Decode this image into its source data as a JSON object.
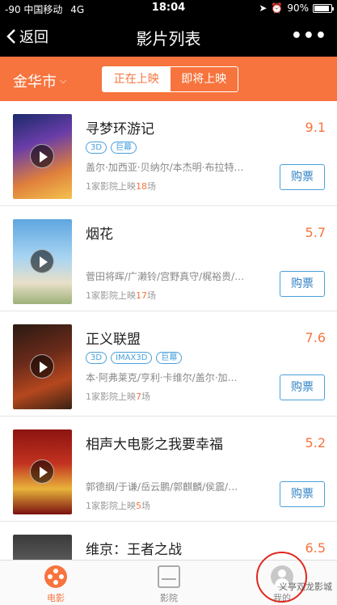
{
  "status_bar": {
    "carrier": "-90 中国移动",
    "network": "4G",
    "time": "18:04",
    "battery": "90%",
    "battery_level": 0.9
  },
  "nav": {
    "back_label": "返回",
    "title": "影片列表",
    "more_label": "•••"
  },
  "filter": {
    "city": "金华市",
    "tabs": [
      {
        "label": "正在上映",
        "active": true
      },
      {
        "label": "即将上映",
        "active": false
      }
    ]
  },
  "movies": [
    {
      "title": "寻梦环游记",
      "score": "9.1",
      "tags": [
        "3D",
        "巨幕"
      ],
      "cast": "盖尔·加西亚·贝纳尔/本杰明·布拉特…",
      "cinemas_prefix": "1家影院上映",
      "showings": "18",
      "showings_suffix": "场",
      "buy_label": "购票"
    },
    {
      "title": "烟花",
      "score": "5.7",
      "tags": [],
      "cast": "菅田将晖/广濑铃/宫野真守/梶裕贵/…",
      "cinemas_prefix": "1家影院上映",
      "showings": "17",
      "showings_suffix": "场",
      "buy_label": "购票"
    },
    {
      "title": "正义联盟",
      "score": "7.6",
      "tags": [
        "3D",
        "IMAX3D",
        "巨幕"
      ],
      "cast": "本·阿弗莱克/亨利·卡维尔/盖尔·加…",
      "cinemas_prefix": "1家影院上映",
      "showings": "7",
      "showings_suffix": "场",
      "buy_label": "购票"
    },
    {
      "title": "相声大电影之我要幸福",
      "score": "5.2",
      "tags": [],
      "cast": "郭德纲/于谦/岳云鹏/郭麒麟/侯震/…",
      "cinemas_prefix": "1家影院上映",
      "showings": "5",
      "showings_suffix": "场",
      "buy_label": "购票"
    },
    {
      "title": "维京：王者之战",
      "score": "6.5"
    }
  ],
  "tab_bar": {
    "items": [
      {
        "label": "电影",
        "color": "#f7743e"
      },
      {
        "label": "影院",
        "color": "#888888"
      },
      {
        "label": "我的",
        "color": "#888888"
      }
    ]
  },
  "watermark": "义亭双龙影城",
  "colors": {
    "accent": "#f7743e",
    "link_blue": "#4aa0dc",
    "annotation_red": "#e0281e"
  }
}
